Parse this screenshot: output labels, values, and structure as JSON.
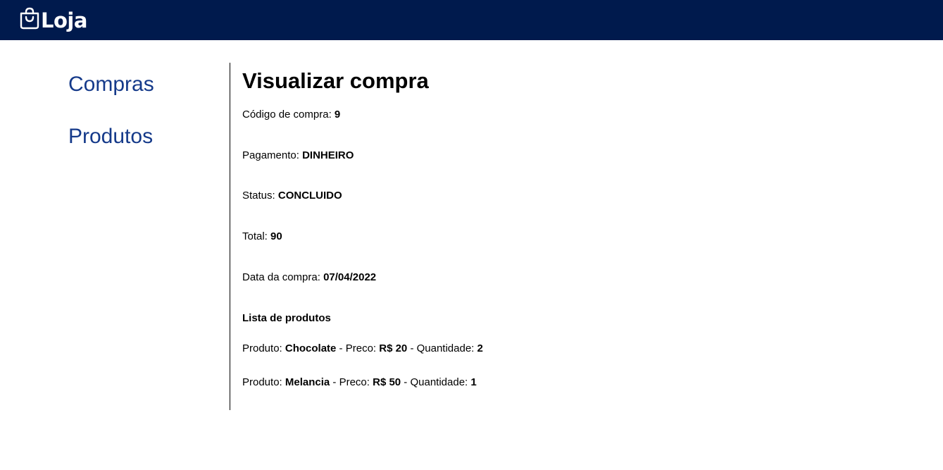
{
  "header": {
    "brand_icon": "shopping-bag-icon",
    "brand_name": "Loja",
    "background": "#001a4d"
  },
  "sidebar": {
    "items": [
      {
        "label": "Compras"
      },
      {
        "label": "Produtos"
      }
    ],
    "link_color": "#153a8a"
  },
  "main": {
    "title": "Visualizar compra",
    "fields": {
      "code": {
        "label": "Código de compra: ",
        "value": "9"
      },
      "payment": {
        "label": "Pagamento: ",
        "value": "DINHEIRO"
      },
      "status": {
        "label": "Status: ",
        "value": "CONCLUIDO"
      },
      "total": {
        "label": "Total: ",
        "value": "90"
      },
      "date": {
        "label": "Data da compra: ",
        "value": "07/04/2022"
      }
    },
    "products_heading": "Lista de produtos",
    "products": [
      {
        "product_label": "Produto: ",
        "name": "Chocolate",
        "price_label": " - Preco: ",
        "price": "R$ 20",
        "qty_label": " - Quantidade: ",
        "quantity": "2"
      },
      {
        "product_label": "Produto: ",
        "name": "Melancia",
        "price_label": " - Preco: ",
        "price": "R$ 50",
        "qty_label": " - Quantidade: ",
        "quantity": "1"
      }
    ]
  }
}
